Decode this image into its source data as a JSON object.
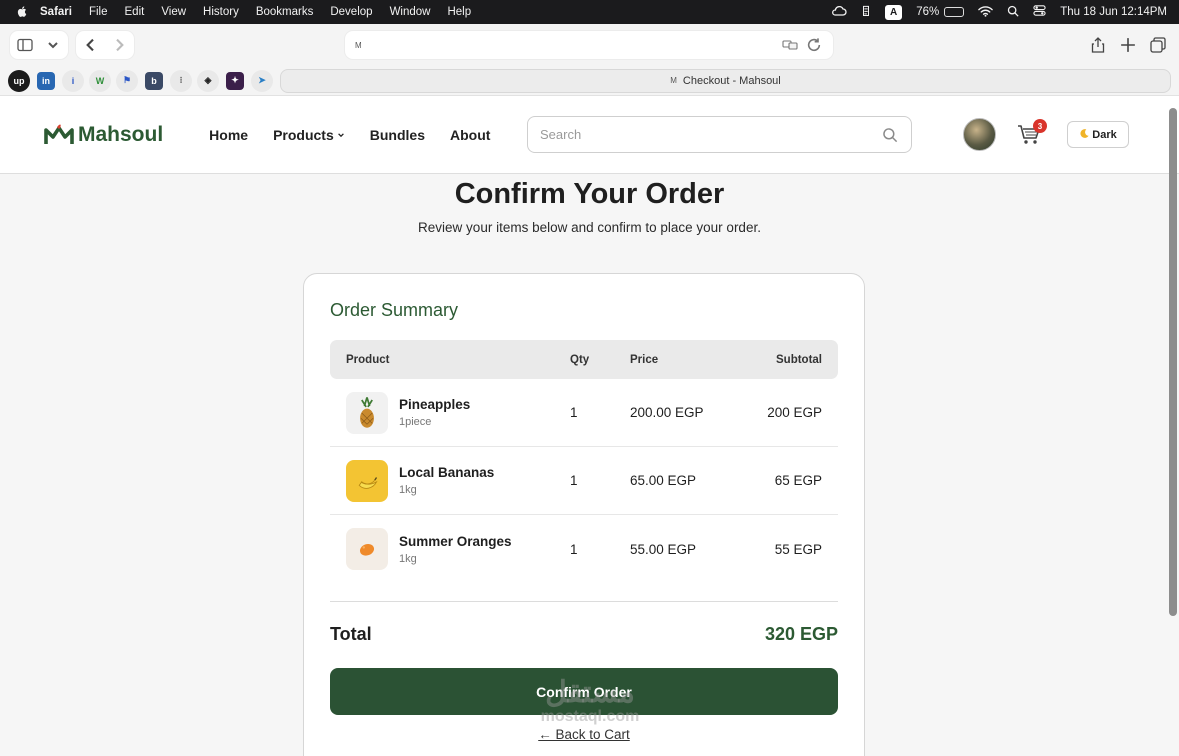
{
  "menubar": {
    "app": "Safari",
    "items": [
      "File",
      "Edit",
      "View",
      "History",
      "Bookmarks",
      "Develop",
      "Window",
      "Help"
    ],
    "input_indicator": "A",
    "battery": "76%",
    "battery_level": 0.76,
    "clock": "Thu 18 Jun  12:14PM"
  },
  "browser": {
    "url_favicon": "M",
    "tab_title": "Checkout - Mahsoul",
    "favorites": [
      "upwork",
      "linkedin",
      "info",
      "webflow",
      "flag",
      "b",
      "dots",
      "codepen",
      "figma",
      "send"
    ]
  },
  "site": {
    "logo_text": "Mahsoul",
    "nav": {
      "home": "Home",
      "products": "Products",
      "bundles": "Bundles",
      "about": "About"
    },
    "search_placeholder": "Search",
    "cart_count": "3",
    "theme_toggle": "Dark"
  },
  "page": {
    "title": "Confirm Your Order",
    "subtitle": "Review your items below and confirm to place your order."
  },
  "summary": {
    "heading": "Order Summary",
    "columns": {
      "product": "Product",
      "qty": "Qty",
      "price": "Price",
      "subtotal": "Subtotal"
    },
    "items": [
      {
        "name": "Pineapples",
        "unit": "1piece",
        "qty": "1",
        "price": "200.00 EGP",
        "subtotal": "200 EGP"
      },
      {
        "name": "Local Bananas",
        "unit": "1kg",
        "qty": "1",
        "price": "65.00 EGP",
        "subtotal": "65 EGP"
      },
      {
        "name": "Summer Oranges",
        "unit": "1kg",
        "qty": "1",
        "price": "55.00 EGP",
        "subtotal": "55 EGP"
      }
    ],
    "total_label": "Total",
    "total_value": "320 EGP",
    "confirm_label": "Confirm Order",
    "back_label": "← Back to Cart"
  },
  "watermark": {
    "arabic": "مستقل",
    "latin": "mostaql.com"
  },
  "colors": {
    "brand_green": "#2c5a33",
    "button_green": "#2b5234",
    "badge_red": "#d9342b"
  }
}
